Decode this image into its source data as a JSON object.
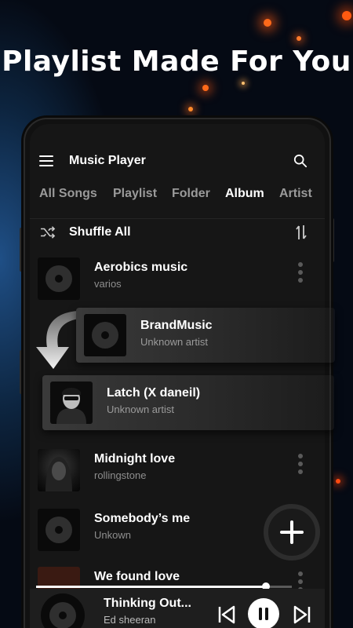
{
  "headline": "Playlist Made For You",
  "app": {
    "title": "Music Player"
  },
  "tabs": [
    {
      "label": "All Songs",
      "active": false
    },
    {
      "label": "Playlist",
      "active": false
    },
    {
      "label": "Folder",
      "active": false
    },
    {
      "label": "Album",
      "active": true
    },
    {
      "label": "Artist",
      "active": false
    }
  ],
  "shuffle_label": "Shuffle All",
  "songs": [
    {
      "title": "Aerobics music",
      "artist": "varios",
      "art": "disc"
    },
    {
      "title": "BrandMusic",
      "artist": "Unknown artist",
      "art": "disc"
    },
    {
      "title": "Latch (X daneil)",
      "artist": "Unknown artist",
      "art": "photo"
    },
    {
      "title": "Midnight love",
      "artist": "rollingstone",
      "art": "photo"
    },
    {
      "title": "Somebody’s me",
      "artist": "Unkown",
      "art": "disc"
    },
    {
      "title": "We found love",
      "artist": "",
      "art": "photo"
    }
  ],
  "now_playing": {
    "title": "Thinking Out...",
    "artist": "Ed sheeran",
    "progress": 0.9
  },
  "icons": [
    "menu-icon",
    "search-icon",
    "shuffle-icon",
    "sort-icon",
    "more-icon",
    "add-icon",
    "previous-icon",
    "pause-icon",
    "next-icon",
    "curved-arrow-icon"
  ],
  "colors": {
    "background": "#050a14",
    "screen": "#161616",
    "accent": "#ffffff"
  }
}
